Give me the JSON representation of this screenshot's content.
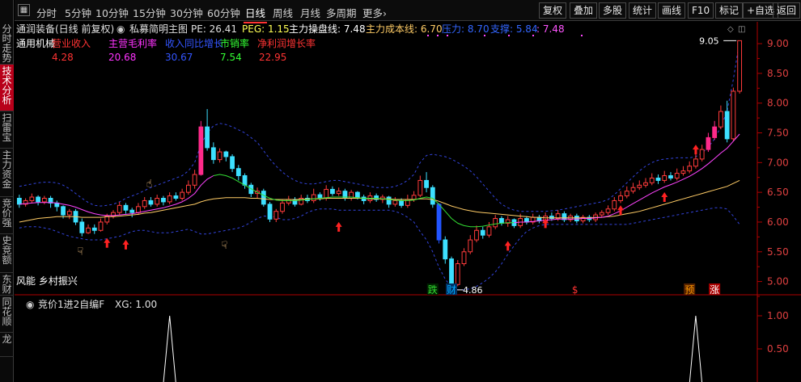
{
  "sidebar": {
    "tabs": [
      {
        "label": "分时走势",
        "active": false
      },
      {
        "label": "技术分析",
        "active": true
      },
      {
        "label": "扫雷宝",
        "active": false
      },
      {
        "label": "主力资金",
        "active": false
      },
      {
        "label": "竞价强",
        "active": false
      },
      {
        "label": "史竞额",
        "active": false
      },
      {
        "label": "东财",
        "active": false
      },
      {
        "label": "同花顺",
        "active": false
      },
      {
        "label": "龙",
        "active": false
      }
    ]
  },
  "toolbar": {
    "periods": [
      {
        "label": "分时",
        "active": false
      },
      {
        "label": "5分钟",
        "active": false
      },
      {
        "label": "10分钟",
        "active": false
      },
      {
        "label": "15分钟",
        "active": false
      },
      {
        "label": "30分钟",
        "active": false
      },
      {
        "label": "60分钟",
        "active": false
      },
      {
        "label": "日线",
        "active": true
      },
      {
        "label": "周线",
        "active": false
      },
      {
        "label": "月线",
        "active": false
      },
      {
        "label": "多周期",
        "active": false
      },
      {
        "label": "更多›",
        "active": false
      }
    ],
    "buttons": [
      "复权",
      "叠加",
      "多股",
      "统计",
      "画线",
      "F10",
      "标记",
      "+自选",
      "返回"
    ]
  },
  "header": {
    "stock_title": "通润装备(日线 前复权)",
    "indicator_main": "私募简明主图",
    "pe": "PE: 26.41",
    "peg": "PEG: 1.15",
    "control_line": "主力操盘线: 7.48",
    "cost_line": "主力成本线: 6.70",
    "pressure": "压力: 8.70",
    "support": "支撑: 5.84",
    "support_extra": ": 7.48"
  },
  "fundamentals": {
    "industry": "通用机械",
    "items": [
      {
        "label": "营业收入",
        "value": "4.28",
        "color": "#ff3333"
      },
      {
        "label": "主营毛利率",
        "value": "20.68",
        "color": "#ff33ff"
      },
      {
        "label": "收入同比增长",
        "value": "30.67",
        "color": "#3355ff"
      },
      {
        "label": "市销率",
        "value": "7.54",
        "color": "#33ff33"
      },
      {
        "label": "净利润增长率",
        "value": "22.95",
        "color": "#ff3333"
      }
    ]
  },
  "concepts": "风能 乡村振兴",
  "annotations": {
    "high_label": "9.05",
    "low_label": "4.86",
    "markers": [
      {
        "text": "跌",
        "color": "#33dd33"
      },
      {
        "text": "财",
        "color": "#00aaff"
      },
      {
        "text": "$",
        "color": "#ff3333"
      },
      {
        "text": "预",
        "color": "#ff9900"
      },
      {
        "text": "涨",
        "color": "#ffffff"
      }
    ]
  },
  "sub_indicator": {
    "title": "竞价1进2自编F",
    "xg_value": "XG: 1.00",
    "axis": [
      "1.00",
      "0.50"
    ]
  },
  "price_axis": [
    "9.00",
    "8.50",
    "8.00",
    "7.50",
    "7.00",
    "6.50",
    "6.00",
    "5.50",
    "5.00"
  ],
  "colors": {
    "up": "#ff3b3b",
    "down": "#3de0ff",
    "highlight_up": "#ff2a8a",
    "control_line": "#ff44ff",
    "cost_line": "#ffcc66",
    "bollinger": "#3344dd",
    "axis": "#b00000"
  },
  "chart_data": {
    "type": "candlestick",
    "ylim": [
      4.75,
      9.15
    ],
    "candles": [
      [
        6.4,
        6.3,
        6.46,
        6.24
      ],
      [
        6.3,
        6.36,
        6.4,
        6.26
      ],
      [
        6.36,
        6.42,
        6.48,
        6.32
      ],
      [
        6.42,
        6.34,
        6.45,
        6.28
      ],
      [
        6.34,
        6.4,
        6.44,
        6.3
      ],
      [
        6.4,
        6.32,
        6.44,
        6.24
      ],
      [
        6.32,
        6.26,
        6.36,
        6.18
      ],
      [
        6.26,
        6.12,
        6.28,
        6.06
      ],
      [
        6.12,
        6.18,
        6.22,
        6.05
      ],
      [
        6.18,
        6.0,
        6.22,
        5.95
      ],
      [
        6.0,
        5.82,
        6.06,
        5.76
      ],
      [
        5.82,
        5.9,
        5.96,
        5.8
      ],
      [
        5.9,
        5.86,
        5.96,
        5.8
      ],
      [
        5.86,
        6.0,
        6.06,
        5.84
      ],
      [
        6.0,
        6.1,
        6.14,
        5.96
      ],
      [
        6.1,
        6.16,
        6.2,
        6.06
      ],
      [
        6.16,
        6.28,
        6.34,
        6.12
      ],
      [
        6.28,
        6.2,
        6.32,
        6.14
      ],
      [
        6.2,
        6.16,
        6.24,
        6.08
      ],
      [
        6.16,
        6.26,
        6.32,
        6.12
      ],
      [
        6.26,
        6.36,
        6.42,
        6.22
      ],
      [
        6.36,
        6.3,
        6.42,
        6.26
      ],
      [
        6.3,
        6.4,
        6.46,
        6.26
      ],
      [
        6.4,
        6.34,
        6.44,
        6.28
      ],
      [
        6.34,
        6.44,
        6.5,
        6.3
      ],
      [
        6.44,
        6.4,
        6.5,
        6.36
      ],
      [
        6.4,
        6.5,
        6.56,
        6.36
      ],
      [
        6.5,
        6.62,
        6.7,
        6.46
      ],
      [
        6.62,
        6.8,
        6.88,
        6.56
      ],
      [
        6.8,
        7.6,
        7.7,
        6.78
      ],
      [
        7.6,
        7.25,
        7.9,
        7.2
      ],
      [
        7.25,
        7.05,
        7.34,
        6.98
      ],
      [
        7.05,
        7.18,
        7.24,
        7.0
      ],
      [
        7.18,
        7.1,
        7.2,
        7.02
      ],
      [
        7.1,
        6.9,
        7.14,
        6.84
      ],
      [
        6.9,
        6.78,
        6.96,
        6.7
      ],
      [
        6.78,
        6.62,
        6.82,
        6.56
      ],
      [
        6.62,
        6.48,
        6.66,
        6.42
      ],
      [
        6.48,
        6.52,
        6.58,
        6.4
      ],
      [
        6.52,
        6.3,
        6.56,
        6.26
      ],
      [
        6.3,
        6.05,
        6.34,
        6.0
      ],
      [
        6.05,
        6.18,
        6.22,
        6.0
      ],
      [
        6.18,
        6.32,
        6.38,
        6.14
      ],
      [
        6.32,
        6.38,
        6.44,
        6.28
      ],
      [
        6.38,
        6.3,
        6.42,
        6.26
      ],
      [
        6.3,
        6.4,
        6.46,
        6.28
      ],
      [
        6.4,
        6.36,
        6.46,
        6.32
      ],
      [
        6.36,
        6.46,
        6.56,
        6.32
      ],
      [
        6.46,
        6.4,
        6.5,
        6.36
      ],
      [
        6.4,
        6.55,
        6.62,
        6.36
      ],
      [
        6.55,
        6.48,
        6.6,
        6.44
      ],
      [
        6.48,
        6.52,
        6.58,
        6.44
      ],
      [
        6.52,
        6.4,
        6.56,
        6.36
      ],
      [
        6.4,
        6.5,
        6.54,
        6.36
      ],
      [
        6.5,
        6.42,
        6.52,
        6.38
      ],
      [
        6.42,
        6.36,
        6.46,
        6.3
      ],
      [
        6.36,
        6.44,
        6.5,
        6.32
      ],
      [
        6.44,
        6.38,
        6.48,
        6.34
      ],
      [
        6.38,
        6.42,
        6.46,
        6.32
      ],
      [
        6.42,
        6.3,
        6.44,
        6.24
      ],
      [
        6.3,
        6.36,
        6.42,
        6.26
      ],
      [
        6.36,
        6.28,
        6.4,
        6.24
      ],
      [
        6.28,
        6.38,
        6.46,
        6.24
      ],
      [
        6.38,
        6.45,
        6.52,
        6.34
      ],
      [
        6.45,
        6.7,
        6.78,
        6.42
      ],
      [
        6.7,
        6.58,
        6.84,
        6.5
      ],
      [
        6.58,
        6.3,
        6.62,
        6.24
      ],
      [
        6.3,
        5.7,
        6.32,
        5.64
      ],
      [
        5.7,
        5.38,
        5.76,
        5.3
      ],
      [
        5.38,
        4.95,
        5.42,
        4.86
      ],
      [
        4.95,
        5.3,
        5.36,
        4.92
      ],
      [
        5.3,
        5.5,
        5.56,
        5.26
      ],
      [
        5.5,
        5.7,
        5.78,
        5.46
      ],
      [
        5.7,
        5.86,
        5.94,
        5.66
      ],
      [
        5.86,
        5.78,
        5.92,
        5.72
      ],
      [
        5.78,
        5.92,
        6.0,
        5.74
      ],
      [
        5.92,
        6.06,
        6.12,
        5.88
      ],
      [
        6.06,
        5.98,
        6.1,
        5.94
      ],
      [
        5.98,
        6.04,
        6.1,
        5.92
      ],
      [
        6.04,
        5.94,
        6.06,
        5.9
      ],
      [
        5.94,
        6.06,
        6.14,
        5.9
      ],
      [
        6.06,
        6.0,
        6.1,
        5.96
      ],
      [
        6.0,
        6.08,
        6.14,
        5.96
      ],
      [
        6.08,
        6.02,
        6.12,
        5.98
      ],
      [
        6.02,
        6.1,
        6.16,
        5.98
      ],
      [
        6.1,
        6.06,
        6.16,
        6.02
      ],
      [
        6.06,
        6.14,
        6.2,
        6.02
      ],
      [
        6.14,
        6.04,
        6.18,
        6.0
      ],
      [
        6.04,
        6.1,
        6.14,
        6.0
      ],
      [
        6.1,
        6.02,
        6.14,
        5.98
      ],
      [
        6.02,
        6.08,
        6.12,
        5.98
      ],
      [
        6.08,
        6.04,
        6.12,
        6.0
      ],
      [
        6.04,
        6.12,
        6.16,
        6.0
      ],
      [
        6.12,
        6.16,
        6.2,
        6.08
      ],
      [
        6.16,
        6.22,
        6.28,
        6.12
      ],
      [
        6.22,
        6.36,
        6.42,
        6.18
      ],
      [
        6.36,
        6.44,
        6.52,
        6.32
      ],
      [
        6.44,
        6.52,
        6.6,
        6.4
      ],
      [
        6.52,
        6.58,
        6.66,
        6.48
      ],
      [
        6.58,
        6.62,
        6.7,
        6.54
      ],
      [
        6.62,
        6.66,
        6.74,
        6.58
      ],
      [
        6.66,
        6.74,
        6.82,
        6.62
      ],
      [
        6.74,
        6.7,
        6.8,
        6.64
      ],
      [
        6.7,
        6.78,
        6.86,
        6.66
      ],
      [
        6.78,
        6.74,
        6.84,
        6.7
      ],
      [
        6.74,
        6.82,
        6.9,
        6.7
      ],
      [
        6.82,
        6.86,
        6.94,
        6.78
      ],
      [
        6.86,
        6.94,
        7.02,
        6.82
      ],
      [
        6.94,
        7.06,
        7.14,
        6.9
      ],
      [
        7.06,
        7.22,
        7.3,
        7.02
      ],
      [
        7.22,
        7.42,
        7.5,
        7.18
      ],
      [
        7.42,
        7.6,
        7.7,
        7.38
      ],
      [
        7.6,
        7.86,
        7.96,
        7.56
      ],
      [
        7.86,
        7.4,
        8.04,
        7.34
      ],
      [
        7.4,
        8.2,
        8.26,
        7.36
      ],
      [
        8.2,
        9.05,
        9.05,
        8.16
      ]
    ],
    "highlight_index": [
      29,
      69,
      110,
      111
    ],
    "control_line": [
      6.3,
      6.31,
      6.32,
      6.33,
      6.33,
      6.33,
      6.32,
      6.3,
      6.28,
      6.25,
      6.21,
      6.17,
      6.14,
      6.12,
      6.11,
      6.11,
      6.12,
      6.13,
      6.14,
      6.16,
      6.18,
      6.2,
      6.22,
      6.24,
      6.27,
      6.3,
      6.34,
      6.4,
      6.48,
      6.62,
      6.72,
      6.78,
      6.8,
      6.78,
      6.74,
      6.68,
      6.62,
      6.56,
      6.5,
      6.45,
      6.4,
      6.37,
      6.36,
      6.36,
      6.36,
      6.37,
      6.38,
      6.39,
      6.4,
      6.41,
      6.42,
      6.42,
      6.42,
      6.42,
      6.41,
      6.4,
      6.4,
      6.4,
      6.39,
      6.38,
      6.37,
      6.36,
      6.36,
      6.37,
      6.4,
      6.42,
      6.4,
      6.3,
      6.18,
      6.06,
      5.98,
      5.94,
      5.92,
      5.92,
      5.93,
      5.95,
      5.97,
      5.98,
      5.99,
      5.99,
      6.0,
      6.0,
      6.01,
      6.02,
      6.03,
      6.04,
      6.05,
      6.05,
      6.05,
      6.05,
      6.06,
      6.06,
      6.07,
      6.08,
      6.1,
      6.14,
      6.19,
      6.25,
      6.31,
      6.37,
      6.43,
      6.49,
      6.54,
      6.59,
      6.63,
      6.67,
      6.72,
      6.77,
      6.83,
      6.9,
      6.98,
      7.07,
      7.16,
      7.24,
      7.36,
      7.48
    ],
    "cost_line": [
      6.0,
      6.02,
      6.04,
      6.06,
      6.07,
      6.08,
      6.09,
      6.09,
      6.09,
      6.09,
      6.08,
      6.08,
      6.08,
      6.08,
      6.09,
      6.09,
      6.1,
      6.11,
      6.12,
      6.13,
      6.15,
      6.16,
      6.18,
      6.2,
      6.22,
      6.24,
      6.26,
      6.28,
      6.3,
      6.34,
      6.37,
      6.39,
      6.4,
      6.41,
      6.41,
      6.41,
      6.41,
      6.4,
      6.4,
      6.39,
      6.38,
      6.38,
      6.38,
      6.38,
      6.38,
      6.38,
      6.39,
      6.39,
      6.39,
      6.4,
      6.4,
      6.4,
      6.4,
      6.4,
      6.4,
      6.4,
      6.39,
      6.39,
      6.39,
      6.39,
      6.38,
      6.38,
      6.38,
      6.38,
      6.39,
      6.39,
      6.38,
      6.35,
      6.31,
      6.27,
      6.24,
      6.21,
      6.19,
      6.17,
      6.16,
      6.15,
      6.14,
      6.13,
      6.12,
      6.11,
      6.1,
      6.09,
      6.08,
      6.08,
      6.07,
      6.07,
      6.07,
      6.07,
      6.07,
      6.07,
      6.07,
      6.07,
      6.08,
      6.08,
      6.09,
      6.1,
      6.12,
      6.14,
      6.16,
      6.18,
      6.21,
      6.24,
      6.27,
      6.3,
      6.33,
      6.36,
      6.39,
      6.42,
      6.45,
      6.48,
      6.51,
      6.54,
      6.57,
      6.6,
      6.65,
      6.7
    ],
    "boll_upper": [
      6.6,
      6.62,
      6.64,
      6.66,
      6.67,
      6.67,
      6.66,
      6.62,
      6.56,
      6.48,
      6.4,
      6.33,
      6.28,
      6.27,
      6.28,
      6.3,
      6.34,
      6.4,
      6.44,
      6.48,
      6.53,
      6.58,
      6.62,
      6.66,
      6.7,
      6.74,
      6.78,
      6.86,
      7.0,
      7.3,
      7.5,
      7.62,
      7.66,
      7.64,
      7.6,
      7.55,
      7.5,
      7.42,
      7.34,
      7.2,
      7.06,
      6.94,
      6.84,
      6.76,
      6.7,
      6.66,
      6.64,
      6.64,
      6.66,
      6.68,
      6.7,
      6.7,
      6.68,
      6.66,
      6.64,
      6.62,
      6.6,
      6.58,
      6.58,
      6.58,
      6.6,
      6.64,
      6.7,
      6.8,
      7.0,
      7.12,
      7.14,
      7.12,
      7.1,
      7.06,
      7.0,
      6.94,
      6.86,
      6.76,
      6.64,
      6.52,
      6.4,
      6.3,
      6.24,
      6.2,
      6.18,
      6.18,
      6.18,
      6.18,
      6.18,
      6.19,
      6.2,
      6.22,
      6.24,
      6.26,
      6.28,
      6.3,
      6.32,
      6.34,
      6.38,
      6.46,
      6.56,
      6.66,
      6.76,
      6.86,
      6.94,
      7.0,
      7.04,
      7.06,
      7.07,
      7.08,
      7.08,
      7.08,
      7.1,
      7.16,
      7.26,
      7.4,
      7.6,
      7.86,
      8.4,
      9.05
    ],
    "boll_lower": [
      5.9,
      5.92,
      5.92,
      5.92,
      5.9,
      5.88,
      5.84,
      5.8,
      5.76,
      5.74,
      5.72,
      5.7,
      5.7,
      5.7,
      5.72,
      5.74,
      5.76,
      5.8,
      5.84,
      5.86,
      5.86,
      5.84,
      5.82,
      5.82,
      5.82,
      5.84,
      5.86,
      5.88,
      5.84,
      5.8,
      5.8,
      5.82,
      5.84,
      5.86,
      5.88,
      5.9,
      5.94,
      6.0,
      6.06,
      6.1,
      6.1,
      6.08,
      6.04,
      6.04,
      6.06,
      6.1,
      6.16,
      6.2,
      6.22,
      6.22,
      6.22,
      6.2,
      6.2,
      6.2,
      6.2,
      6.2,
      6.2,
      6.2,
      6.2,
      6.2,
      6.18,
      6.14,
      6.08,
      6.0,
      5.84,
      5.7,
      5.5,
      5.24,
      5.04,
      4.9,
      4.86,
      4.86,
      4.88,
      4.92,
      4.98,
      5.06,
      5.16,
      5.3,
      5.46,
      5.6,
      5.74,
      5.84,
      5.9,
      5.94,
      5.96,
      5.96,
      5.96,
      5.96,
      5.96,
      5.96,
      5.96,
      5.96,
      5.96,
      5.96,
      5.96,
      5.96,
      5.96,
      5.96,
      5.98,
      6.0,
      6.02,
      6.04,
      6.06,
      6.08,
      6.1,
      6.12,
      6.14,
      6.16,
      6.18,
      6.2,
      6.22,
      6.24,
      6.24,
      6.22,
      6.1,
      5.96
    ],
    "up_arrows": [
      [
        14,
        5.65
      ],
      [
        17,
        5.62
      ],
      [
        51,
        5.92
      ],
      [
        78,
        5.6
      ],
      [
        84,
        5.98
      ],
      [
        96,
        6.2
      ],
      [
        103,
        6.42
      ],
      [
        108,
        7.22
      ]
    ],
    "hand_icons": [
      [
        10,
        5.52,
        "down"
      ],
      [
        21,
        6.66,
        "up"
      ],
      [
        33,
        5.62,
        "down"
      ]
    ],
    "sub_signal_points": [
      [
        24,
        1.0
      ],
      [
        108,
        1.0
      ]
    ]
  }
}
